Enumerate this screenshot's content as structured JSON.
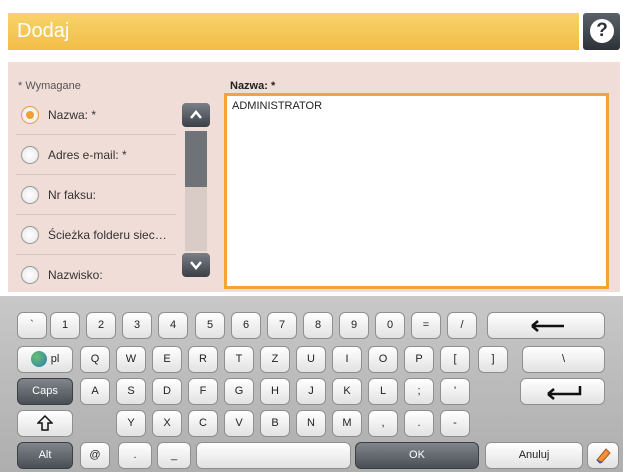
{
  "header": {
    "title": "Dodaj",
    "help_icon": "question-mark-icon"
  },
  "form": {
    "required_note": "* Wymagane",
    "fields": [
      {
        "label": "Nazwa: *",
        "selected": true
      },
      {
        "label": "Adres e-mail: *",
        "selected": false
      },
      {
        "label": "Nr faksu:",
        "selected": false
      },
      {
        "label": "Ścieżka folderu siec…",
        "selected": false
      },
      {
        "label": "Nazwisko:",
        "selected": false
      }
    ],
    "active_field_label": "Nazwa: *",
    "active_field_value": "ADMINISTRATOR"
  },
  "keyboard": {
    "row1": [
      "`",
      "1",
      "2",
      "3",
      "4",
      "5",
      "6",
      "7",
      "8",
      "9",
      "0",
      "=",
      "/"
    ],
    "row2": [
      "pl",
      "Q",
      "W",
      "E",
      "R",
      "T",
      "Z",
      "U",
      "I",
      "O",
      "P",
      "[",
      "]",
      "\\"
    ],
    "row3": [
      "Caps",
      "A",
      "S",
      "D",
      "F",
      "G",
      "H",
      "J",
      "K",
      "L",
      ";",
      "'"
    ],
    "row4": [
      "Y",
      "X",
      "C",
      "V",
      "B",
      "N",
      "M",
      ",",
      ".",
      "-"
    ],
    "row5": {
      "alt": "Alt",
      "at": "@",
      "dot": ".",
      "underscore": "_",
      "ok": "OK",
      "cancel": "Anuluj"
    }
  },
  "colors": {
    "accent": "#f1a43a",
    "header": "#f2bd46"
  }
}
